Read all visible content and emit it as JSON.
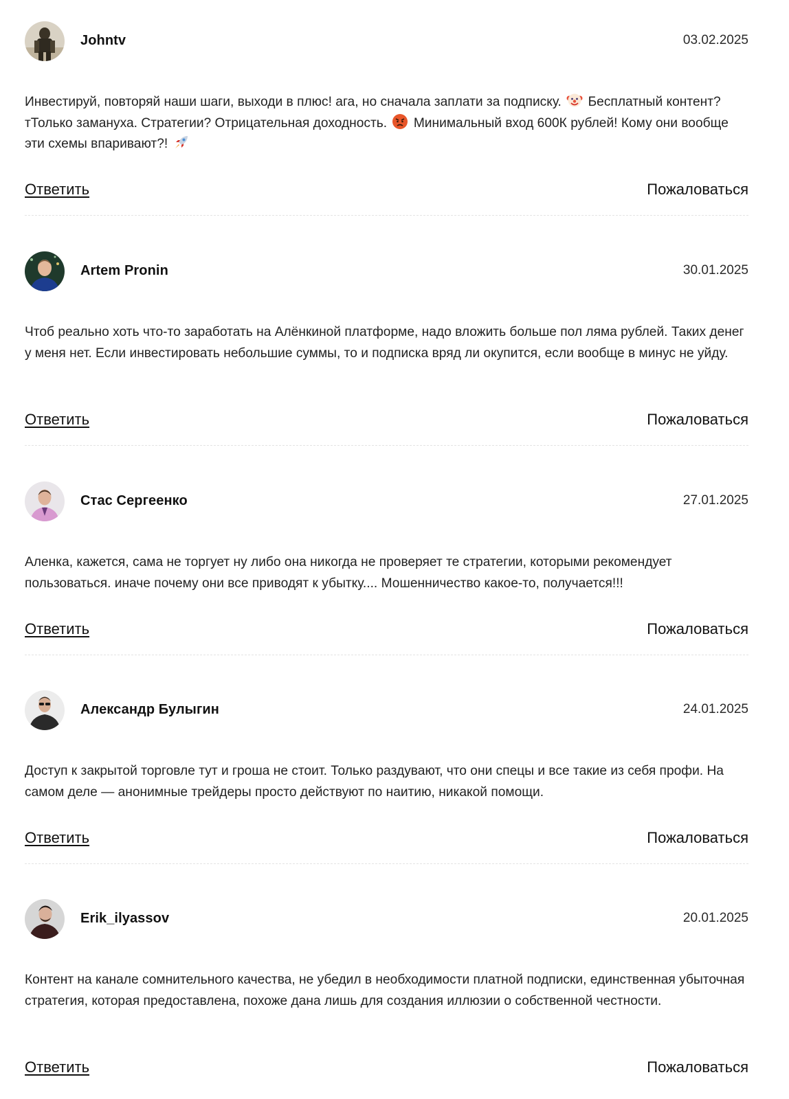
{
  "actions": {
    "reply_label": "Ответить",
    "report_label": "Пожаловаться"
  },
  "comments": [
    {
      "author": "Johntv",
      "date": "03.02.2025",
      "text_part1": "Инвестируй, повторяй наши шаги, выходи в плюс! ага, но сначала заплати за подписку.",
      "text_part2": "Бесплатный контент? тТолько замануха. Стратегии? Отрицательная доходность.",
      "text_part3": "Минимальный вход 600К рублей! Кому они вообще эти схемы впаривают?!",
      "emojis": [
        "clown-face-emoji",
        "angry-face-emoji",
        "rocket-emoji"
      ]
    },
    {
      "author": "Artem Pronin",
      "date": "30.01.2025",
      "text": "Чтоб реально хоть что-то заработать на Алёнкиной платформе, надо вложить больше пол ляма рублей. Таких денег у меня нет. Если инвестировать небольшие суммы, то и подписка вряд ли окупится, если вообще в минус не уйду."
    },
    {
      "author": "Стас Сергеенко",
      "date": "27.01.2025",
      "text": "Аленка, кажется, сама не торгует ну либо она никогда не проверяет те стратегии, которыми рекомендует пользоваться. иначе почему они все приводят к убытку.... Мошенничество какое-то, получается!!!"
    },
    {
      "author": "Александр Булыгин",
      "date": "24.01.2025",
      "text": "Доступ к закрытой торговле тут и гроша не стоит. Только раздувают, что они спецы и все такие из себя профи. На самом деле — анонимные трейдеры просто действуют по наитию, никакой помощи."
    },
    {
      "author": "Erik_ilyassov",
      "date": "20.01.2025",
      "text": "Контент на канале сомнительного качества, не убедил в необходимости платной подписки, единственная убыточная стратегия, которая предоставлена, похоже дана лишь для создания иллюзии о собственной честности."
    }
  ]
}
